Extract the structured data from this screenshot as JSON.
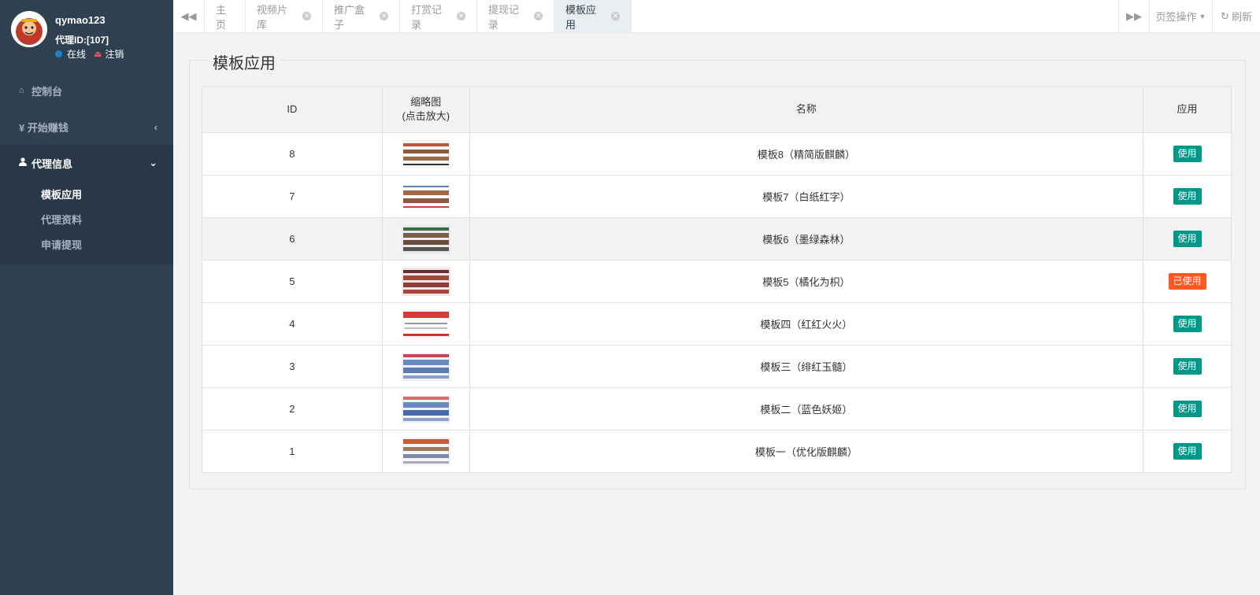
{
  "user": {
    "username": "qymao123",
    "agent_id": "代理ID:[107]",
    "status": "在线",
    "logout": "注销"
  },
  "sidebar": {
    "items": [
      {
        "label": "控制台",
        "icon": "home-icon"
      },
      {
        "label": "¥ 开始赚钱",
        "icon": "yen-icon"
      },
      {
        "label": "代理信息",
        "icon": "user-icon"
      }
    ],
    "sub_items": [
      {
        "label": "模板应用"
      },
      {
        "label": "代理资料"
      },
      {
        "label": "申请提现"
      }
    ]
  },
  "tabs": [
    {
      "label": "主页"
    },
    {
      "label": "视频片库"
    },
    {
      "label": "推广盒子"
    },
    {
      "label": "打赏记录"
    },
    {
      "label": "提现记录"
    },
    {
      "label": "模板应用"
    }
  ],
  "topbar": {
    "tab_ops": "页签操作",
    "refresh": "刷新"
  },
  "page": {
    "title": "模板应用"
  },
  "table": {
    "headers": {
      "id": "ID",
      "thumb_line1": "缩略图",
      "thumb_line2": "(点击放大)",
      "name": "名称",
      "apply": "应用"
    },
    "rows": [
      {
        "id": "8",
        "name": "模板8（精简版麒麟）",
        "action": "使用"
      },
      {
        "id": "7",
        "name": "模板7（白纸红字）",
        "action": "使用"
      },
      {
        "id": "6",
        "name": "模板6（墨绿森林）",
        "action": "使用"
      },
      {
        "id": "5",
        "name": "模板5（橘化为枳）",
        "action": "已使用"
      },
      {
        "id": "4",
        "name": "模板四（红红火火）",
        "action": "使用"
      },
      {
        "id": "3",
        "name": "模板三（绯红玉髓）",
        "action": "使用"
      },
      {
        "id": "2",
        "name": "模板二（蓝色妖姬）",
        "action": "使用"
      },
      {
        "id": "1",
        "name": "模板一（优化版麒麟）",
        "action": "使用"
      }
    ]
  },
  "colors": {
    "sidebar_bg": "#2f4050",
    "use_btn": "#009688",
    "used_btn": "#ff5722",
    "online_dot": "#1c84c6"
  }
}
